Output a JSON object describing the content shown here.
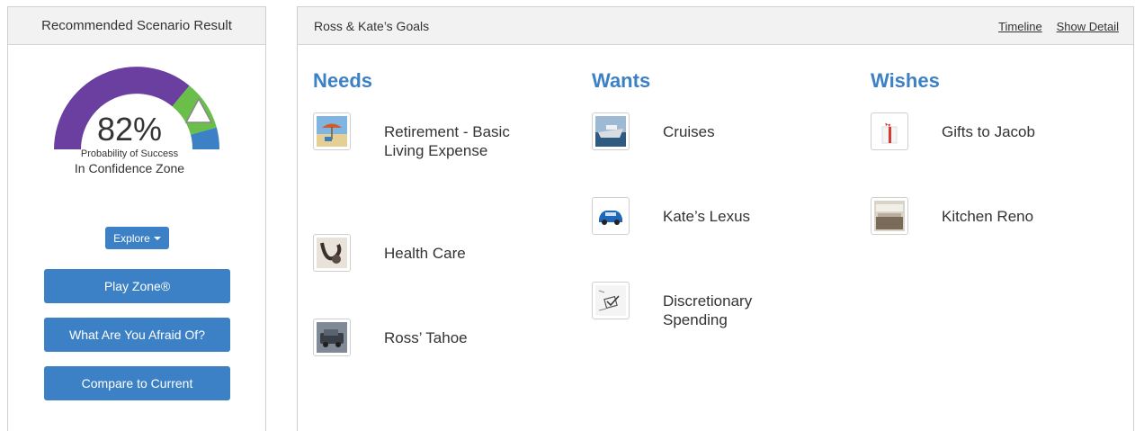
{
  "left_panel": {
    "title": "Recommended Scenario Result",
    "gauge": {
      "percent_label": "82%",
      "probability_value": 82,
      "subtitle": "Probability of Success",
      "zone": "In Confidence Zone",
      "colors": {
        "low": "#6b3fa0",
        "confidence": "#6abf4b",
        "high": "#3c80c6"
      }
    },
    "explore_label": "Explore",
    "buttons": [
      "Play Zone®",
      "What Are You Afraid Of?",
      "Compare to Current"
    ]
  },
  "right_panel": {
    "title": "Ross & Kate’s Goals",
    "links": {
      "timeline": "Timeline",
      "show_detail": "Show Detail"
    },
    "columns": [
      {
        "title": "Needs",
        "goals": [
          "Retirement - Basic Living Expense",
          "Health Care",
          "Ross’ Tahoe"
        ]
      },
      {
        "title": "Wants",
        "goals": [
          "Cruises",
          "Kate’s Lexus",
          "Discretionary Spending"
        ]
      },
      {
        "title": "Wishes",
        "goals": [
          "Gifts to Jacob",
          "Kitchen Reno"
        ]
      }
    ]
  },
  "accent_color": "#3c80c6"
}
